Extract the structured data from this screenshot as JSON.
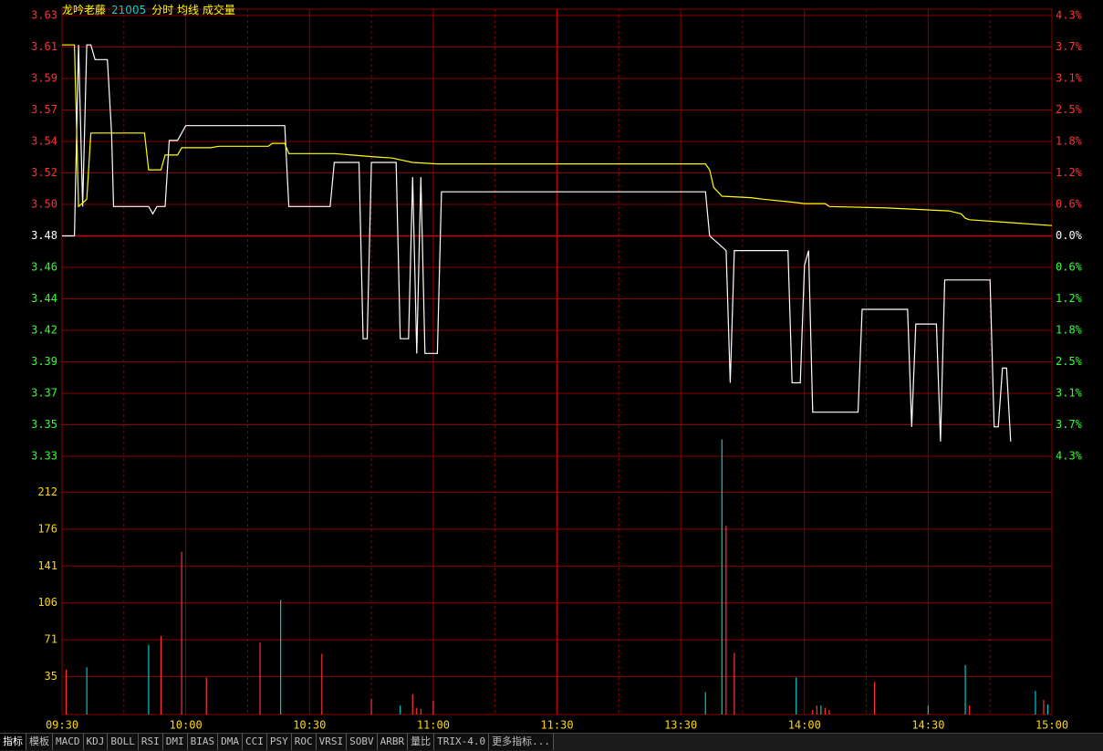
{
  "header": {
    "name": "龙吟老藤",
    "code": "21005",
    "indicators": "分时 均线 成交量"
  },
  "colors": {
    "up": "#ff3232",
    "down": "#32ff32",
    "flat": "#ffffff",
    "grid": "#8b0000",
    "price_line": "#ffffff",
    "avg_line": "#ffff00",
    "vol_up": "#ff3232",
    "vol_down": "#00c8c8",
    "time_label": "#ffd700",
    "vol_label": "#ffd700"
  },
  "chart_data": [
    {
      "type": "line",
      "name": "price",
      "prev_close": 3.48,
      "ylim": [
        3.33,
        3.63
      ],
      "y_ticks": [
        "3.63",
        "3.61",
        "3.59",
        "3.57",
        "3.54",
        "3.52",
        "3.50",
        "3.48",
        "3.46",
        "3.44",
        "3.42",
        "3.39",
        "3.37",
        "3.35",
        "3.33"
      ],
      "pct_ticks": [
        "4.3%",
        "3.7%",
        "3.1%",
        "2.5%",
        "1.8%",
        "1.2%",
        "0.6%",
        "0.0%",
        "0.6%",
        "1.2%",
        "1.8%",
        "2.5%",
        "3.1%",
        "3.7%",
        "4.3%"
      ],
      "x_ticks": [
        "09:30",
        "10:00",
        "10:30",
        "11:00",
        "11:30",
        "13:30",
        "14:00",
        "14:30",
        "15:00"
      ],
      "total_minutes": 240,
      "series": [
        {
          "name": "分时",
          "points": [
            [
              0,
              3.48
            ],
            [
              3,
              3.48
            ],
            [
              4,
              3.61
            ],
            [
              5,
              3.5
            ],
            [
              6,
              3.61
            ],
            [
              7,
              3.61
            ],
            [
              8,
              3.6
            ],
            [
              11,
              3.6
            ],
            [
              12,
              3.55
            ],
            [
              12.5,
              3.5
            ],
            [
              21,
              3.5
            ],
            [
              22,
              3.495
            ],
            [
              23,
              3.5
            ],
            [
              25,
              3.5
            ],
            [
              26,
              3.545
            ],
            [
              28,
              3.545
            ],
            [
              30,
              3.555
            ],
            [
              54,
              3.555
            ],
            [
              55,
              3.5
            ],
            [
              65,
              3.5
            ],
            [
              66,
              3.53
            ],
            [
              72,
              3.53
            ],
            [
              73,
              3.41
            ],
            [
              74,
              3.41
            ],
            [
              75,
              3.53
            ],
            [
              81,
              3.53
            ],
            [
              82,
              3.41
            ],
            [
              84,
              3.41
            ],
            [
              85,
              3.52
            ],
            [
              86,
              3.4
            ],
            [
              87,
              3.52
            ],
            [
              88,
              3.4
            ],
            [
              91,
              3.4
            ],
            [
              92,
              3.51
            ],
            [
              156,
              3.51
            ],
            [
              157,
              3.48
            ],
            [
              161,
              3.47
            ],
            [
              162,
              3.38
            ],
            [
              163,
              3.47
            ],
            [
              176,
              3.47
            ],
            [
              177,
              3.38
            ],
            [
              179,
              3.38
            ],
            [
              180,
              3.46
            ],
            [
              181,
              3.47
            ],
            [
              182,
              3.36
            ],
            [
              193,
              3.36
            ],
            [
              194,
              3.43
            ],
            [
              205,
              3.43
            ],
            [
              206,
              3.35
            ],
            [
              207,
              3.42
            ],
            [
              212,
              3.42
            ],
            [
              213,
              3.34
            ],
            [
              214,
              3.45
            ],
            [
              225,
              3.45
            ],
            [
              226,
              3.35
            ],
            [
              227,
              3.35
            ],
            [
              228,
              3.39
            ],
            [
              229,
              3.39
            ],
            [
              230,
              3.34
            ]
          ]
        },
        {
          "name": "均线",
          "points": [
            [
              0,
              3.61
            ],
            [
              3,
              3.61
            ],
            [
              4,
              3.5
            ],
            [
              6,
              3.505
            ],
            [
              7,
              3.55
            ],
            [
              8,
              3.55
            ],
            [
              20,
              3.55
            ],
            [
              21,
              3.525
            ],
            [
              24,
              3.525
            ],
            [
              25,
              3.535
            ],
            [
              28,
              3.535
            ],
            [
              29,
              3.54
            ],
            [
              36,
              3.54
            ],
            [
              38,
              3.541
            ],
            [
              50,
              3.541
            ],
            [
              51,
              3.543
            ],
            [
              54,
              3.543
            ],
            [
              55,
              3.536
            ],
            [
              66,
              3.536
            ],
            [
              75,
              3.534
            ],
            [
              80,
              3.533
            ],
            [
              85,
              3.53
            ],
            [
              91,
              3.529
            ],
            [
              156,
              3.529
            ],
            [
              157,
              3.525
            ],
            [
              158,
              3.513
            ],
            [
              160,
              3.507
            ],
            [
              167,
              3.506
            ],
            [
              170,
              3.505
            ],
            [
              177,
              3.503
            ],
            [
              180,
              3.502
            ],
            [
              185,
              3.502
            ],
            [
              186,
              3.5
            ],
            [
              200,
              3.499
            ],
            [
              215,
              3.497
            ],
            [
              218,
              3.495
            ],
            [
              219,
              3.492
            ],
            [
              220,
              3.491
            ],
            [
              230,
              3.489
            ],
            [
              240,
              3.487
            ]
          ]
        }
      ]
    },
    {
      "type": "bar",
      "name": "volume",
      "ylim": [
        0,
        230
      ],
      "y_ticks": [
        "212",
        "176",
        "141",
        "106",
        "71",
        "35"
      ],
      "bars": [
        [
          1,
          40,
          "up"
        ],
        [
          6,
          42,
          "down"
        ],
        [
          21,
          62,
          "down"
        ],
        [
          24,
          70,
          "up"
        ],
        [
          29,
          145,
          "up"
        ],
        [
          35,
          33,
          "up"
        ],
        [
          48,
          64,
          "up"
        ],
        [
          53,
          102,
          "down"
        ],
        [
          63,
          54,
          "up"
        ],
        [
          75,
          14,
          "up"
        ],
        [
          82,
          8,
          "down"
        ],
        [
          85,
          18,
          "up"
        ],
        [
          86,
          6,
          "up"
        ],
        [
          87,
          5,
          "up"
        ],
        [
          90,
          12,
          "up"
        ],
        [
          156,
          20,
          "down"
        ],
        [
          160,
          245,
          "down"
        ],
        [
          161,
          168,
          "up"
        ],
        [
          163,
          55,
          "up"
        ],
        [
          178,
          33,
          "down"
        ],
        [
          182,
          4,
          "up"
        ],
        [
          183,
          8,
          "up"
        ],
        [
          184,
          8,
          "down"
        ],
        [
          185,
          6,
          "up"
        ],
        [
          186,
          4,
          "up"
        ],
        [
          197,
          29,
          "up"
        ],
        [
          210,
          8,
          "down"
        ],
        [
          219,
          44,
          "down"
        ],
        [
          220,
          8,
          "up"
        ],
        [
          236,
          21,
          "down"
        ],
        [
          238,
          13,
          "up"
        ],
        [
          239,
          9,
          "down"
        ]
      ]
    }
  ],
  "tabs": [
    "指标",
    "模板",
    "MACD",
    "KDJ",
    "BOLL",
    "RSI",
    "DMI",
    "BIAS",
    "DMA",
    "CCI",
    "PSY",
    "ROC",
    "VRSI",
    "SOBV",
    "ARBR",
    "量比",
    "TRIX-4.0",
    "更多指标..."
  ]
}
